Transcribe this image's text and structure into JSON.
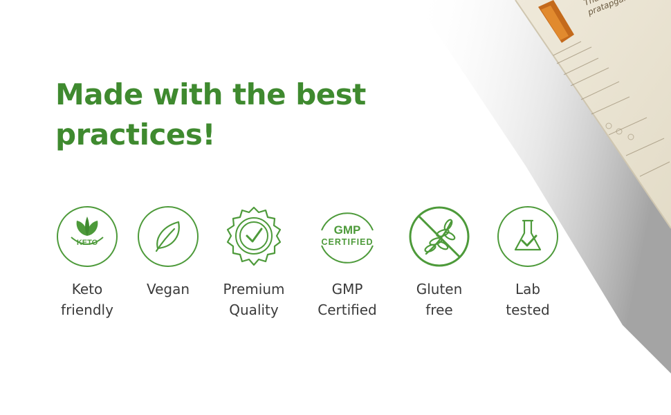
{
  "headline": "Made with the best practices!",
  "badges": [
    {
      "label": "Keto\nfriendly",
      "icon": "keto-leaf-icon",
      "icon_text": "KETO"
    },
    {
      "label": "Vegan",
      "icon": "leaf-icon"
    },
    {
      "label": "Premium\nQuality",
      "icon": "gear-check-icon"
    },
    {
      "label": "GMP\nCertified",
      "icon": "gmp-certified-seal-icon",
      "icon_text_top": "GMP",
      "icon_text_bottom": "CERTIFIED"
    },
    {
      "label": "Gluten\nfree",
      "icon": "no-wheat-icon"
    },
    {
      "label": "Lab\ntested",
      "icon": "flask-check-icon"
    }
  ],
  "product_box": {
    "text": "Thar an\npratapgar"
  },
  "colors": {
    "brand_green": "#3f8a2f",
    "icon_green": "#4d9a3a",
    "label_gray": "#3a3a3a",
    "box_beige": "#ece6d6"
  }
}
